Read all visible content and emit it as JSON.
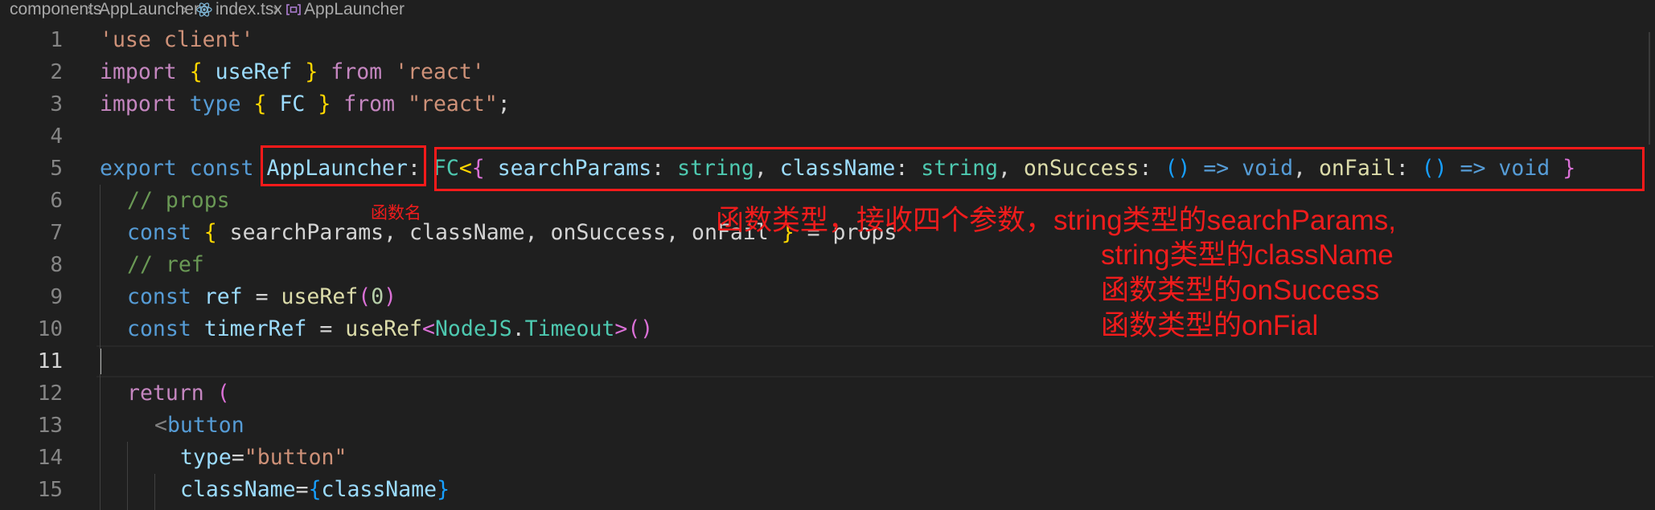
{
  "breadcrumb": {
    "seg1": "components",
    "seg2": "AppLauncher",
    "seg3": "index.tsx",
    "seg4": "AppLauncher",
    "icons": [
      "chevron-right-icon",
      "react-file-icon",
      "symbol-method-icon"
    ]
  },
  "annotations": {
    "function_name": "函数名",
    "line1": "函数类型，接收四个参数，string类型的searchParams,",
    "line2": "string类型的className",
    "line3": "函数类型的onSuccess",
    "line4": "函数类型的onFial"
  },
  "lines": [
    {
      "num": "1"
    },
    {
      "num": "2"
    },
    {
      "num": "3"
    },
    {
      "num": "4"
    },
    {
      "num": "5"
    },
    {
      "num": "6"
    },
    {
      "num": "7"
    },
    {
      "num": "8"
    },
    {
      "num": "9"
    },
    {
      "num": "10"
    },
    {
      "num": "11"
    },
    {
      "num": "12"
    },
    {
      "num": "13"
    },
    {
      "num": "14"
    },
    {
      "num": "15"
    }
  ],
  "code": {
    "l1": {
      "s": "'use client'"
    },
    "l2": {
      "import": "import",
      "ob": "{",
      "name": "useRef",
      "cb": "}",
      "from": "from",
      "s": "'react'"
    },
    "l3": {
      "import": "import",
      "type": "type",
      "ob": "{",
      "name": "FC",
      "cb": "}",
      "from": "from",
      "s": "\"react\"",
      "semi": ";"
    },
    "l5": {
      "export": "export",
      "const": "const",
      "name": "AppLauncher",
      "colon": ":",
      "fc": "FC",
      "lt": "<",
      "ob": "{",
      "p1": "searchParams",
      "t1": "string",
      "p2": "className",
      "t2": "string",
      "p3": "onSuccess",
      "paren": "()",
      "arrow": "=>",
      "void": "void",
      "p4": "onFail",
      "cb": "}"
    },
    "l6": {
      "c": "// props"
    },
    "l7": {
      "const": "const",
      "ob": "{",
      "rest": " searchParams, className, onSuccess, onFail ",
      "cb": "}",
      "eq": " = props"
    },
    "l8": {
      "c": "// ref"
    },
    "l9": {
      "const": "const",
      "name": "ref",
      "eq": " = ",
      "fn": "useRef",
      "op": "(",
      "num": "0",
      "cp": ")"
    },
    "l10": {
      "const": "const",
      "name": "timerRef",
      "eq": " = ",
      "fn": "useRef",
      "lt": "<",
      "ns": "NodeJS",
      "dot": ".",
      "t": "Timeout",
      "gt": ">",
      "parens": "()"
    },
    "l12": {
      "ret": "return",
      "op": "("
    },
    "l13": {
      "lt": "<",
      "tag": "button"
    },
    "l14": {
      "attr": "type",
      "eq": "=",
      "s": "\"button\""
    },
    "l15": {
      "attr": "className",
      "eq": "=",
      "ob": "{",
      "v": "className",
      "cb": "}"
    }
  },
  "colors": {
    "annotation": "#f01c1c",
    "box": "#ff1a1a"
  }
}
